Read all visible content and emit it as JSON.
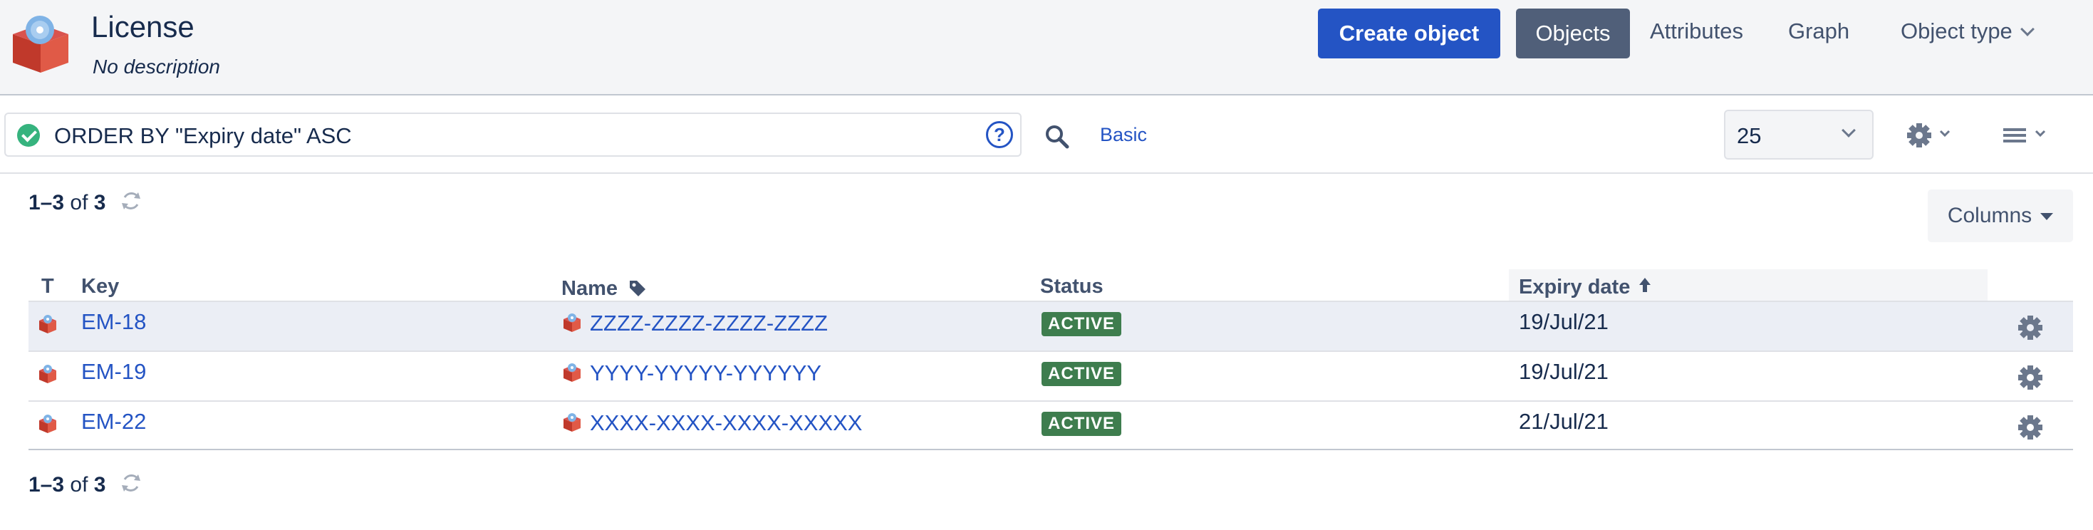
{
  "header": {
    "title": "License",
    "subtitle": "No description",
    "create_label": "Create object",
    "nav": {
      "objects": "Objects",
      "attributes": "Attributes",
      "graph": "Graph",
      "object_type": "Object type"
    }
  },
  "search": {
    "query": "ORDER BY \"Expiry date\" ASC",
    "help": "?",
    "mode": "Basic",
    "page_size": "25"
  },
  "results": {
    "range": "1–3",
    "of": "of",
    "total": "3",
    "columns_label": "Columns"
  },
  "table": {
    "headers": {
      "type": "T",
      "key": "Key",
      "name": "Name",
      "status": "Status",
      "expiry": "Expiry date"
    },
    "rows": [
      {
        "key": "EM-18",
        "name": "ZZZZ-ZZZZ-ZZZZ-ZZZZ",
        "status": "ACTIVE",
        "expiry": "19/Jul/21"
      },
      {
        "key": "EM-19",
        "name": "YYYY-YYYYY-YYYYYY",
        "status": "ACTIVE",
        "expiry": "19/Jul/21"
      },
      {
        "key": "EM-22",
        "name": "XXXX-XXXX-XXXX-XXXXX",
        "status": "ACTIVE",
        "expiry": "21/Jul/21"
      }
    ]
  },
  "colors": {
    "primary": "#2454c4",
    "selected_tab": "#505f79",
    "status_active": "#3e7d4e",
    "valid_query": "#36b37e"
  },
  "icons": [
    "license-box-icon",
    "check-circle-icon",
    "help-icon",
    "search-icon",
    "gear-icon",
    "list-menu-icon",
    "refresh-icon",
    "tag-icon",
    "sort-ascending-icon"
  ]
}
